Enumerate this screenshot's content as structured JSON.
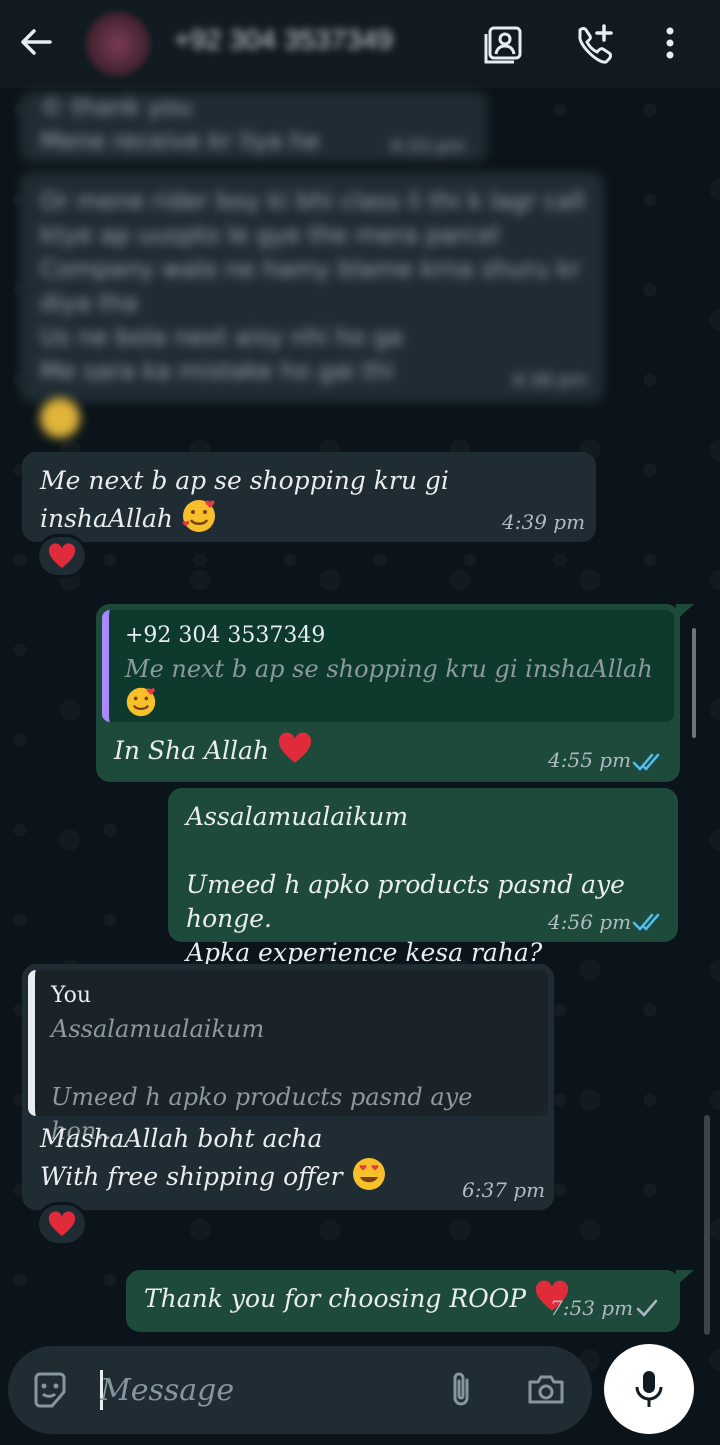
{
  "header": {
    "contact_name": "+92 304 3537349"
  },
  "messages": {
    "blurred_1_line1": "© thank you",
    "blurred_1_line2": "Mene receive kr liya he",
    "blurred_1_time": "4:33 pm",
    "blurred_2_line1": "Or mene rider boy ki bhi class li thi k lagr call",
    "blurred_2_line2": "ktye ap uuspto le gye the mera parcel",
    "blurred_2_line3": "Company walo ne hamy blame krna shuru kr",
    "blurred_2_line4": "diya tha",
    "blurred_2_line5": "Us ne bola next aisy nhi ho ga",
    "blurred_2_line6": "Me sara ka mistake ho gai thi",
    "blurred_2_time": "4:38 pm",
    "m1_text": "Me next b ap se shopping kru gi inshaAllah",
    "m1_time": "4:39 pm",
    "m2_quote_author": "+92 304 3537349",
    "m2_quote_text": "Me next b ap se shopping kru gi inshaAllah",
    "m2_text": "In Sha Allah",
    "m2_time": "4:55 pm",
    "m3_line1": "Assalamualaikum",
    "m3_line2": "Umeed h apko products pasnd aye honge.",
    "m3_line3": "Apka experience kesa raha?",
    "m3_time": "4:56 pm",
    "m4_quote_author": "You",
    "m4_quote_line1": "Assalamualaikum",
    "m4_quote_line2": "Umeed h apko products pasnd aye hon...",
    "m4_line1": "MashaAllah boht acha",
    "m4_line2": "With free shipping offer",
    "m4_time": "6:37 pm",
    "m5_text": "Thank you for choosing ROOP",
    "m5_time": "7:53 pm"
  },
  "composer": {
    "placeholder": "Message"
  },
  "icons": [
    "back-arrow-icon",
    "contact-card-icon",
    "call-add-icon",
    "more-vert-icon",
    "sticker-icon",
    "attach-icon",
    "camera-icon",
    "mic-icon",
    "heart-emoji",
    "smiling-hearts-emoji",
    "heart-eyes-emoji",
    "double-check-icon",
    "single-check-icon"
  ],
  "colors": {
    "background": "#0b141a",
    "incoming_bubble": "#202c33",
    "outgoing_bubble": "#1e4a3b",
    "read_ticks": "#53bdeb",
    "quote_bar": "#a78bfa"
  }
}
